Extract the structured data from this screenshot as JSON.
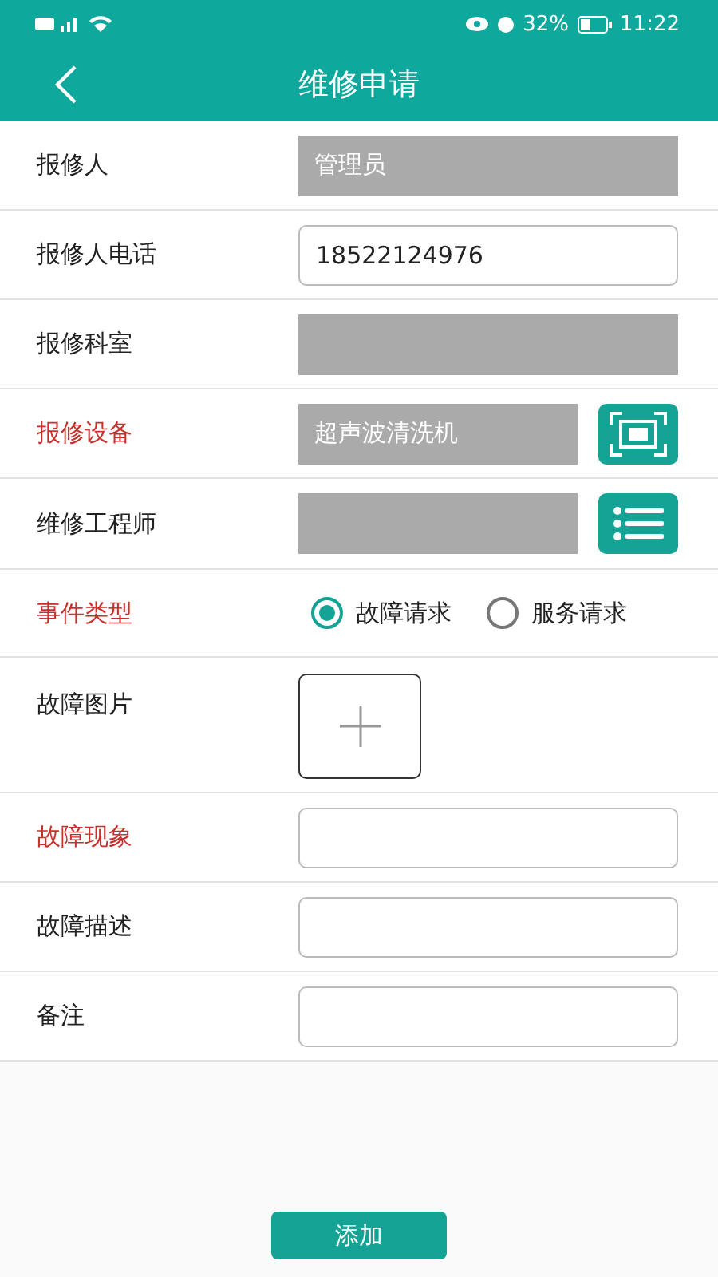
{
  "status_bar": {
    "battery": "32%",
    "time": "11:22"
  },
  "header": {
    "title": "维修申请"
  },
  "fields": [
    {
      "label": "报修人",
      "required": false,
      "kind": "text",
      "disabled": true,
      "value": "管理员"
    },
    {
      "label": "报修人电话",
      "required": false,
      "kind": "text",
      "disabled": false,
      "value": "18522124976"
    },
    {
      "label": "报修科室",
      "required": false,
      "kind": "text",
      "disabled": true
    },
    {
      "label": "报修设备",
      "required": true,
      "kind": "scan",
      "disabled": true,
      "value": "超声波清洗机"
    },
    {
      "label": "维修工程师",
      "required": false,
      "kind": "list",
      "disabled": true
    },
    {
      "label": "事件类型",
      "required": true,
      "kind": "radio",
      "options": [
        {
          "label": "故障请求",
          "selected": true
        },
        {
          "label": "服务请求",
          "selected": false
        }
      ]
    },
    {
      "label": "故障图片",
      "required": false,
      "kind": "photo"
    },
    {
      "label": "故障现象",
      "required": true,
      "kind": "text",
      "disabled": false
    },
    {
      "label": "故障描述",
      "required": false,
      "kind": "text",
      "disabled": false
    },
    {
      "label": "备注",
      "required": false,
      "kind": "text",
      "disabled": false
    }
  ],
  "submit": "添加"
}
